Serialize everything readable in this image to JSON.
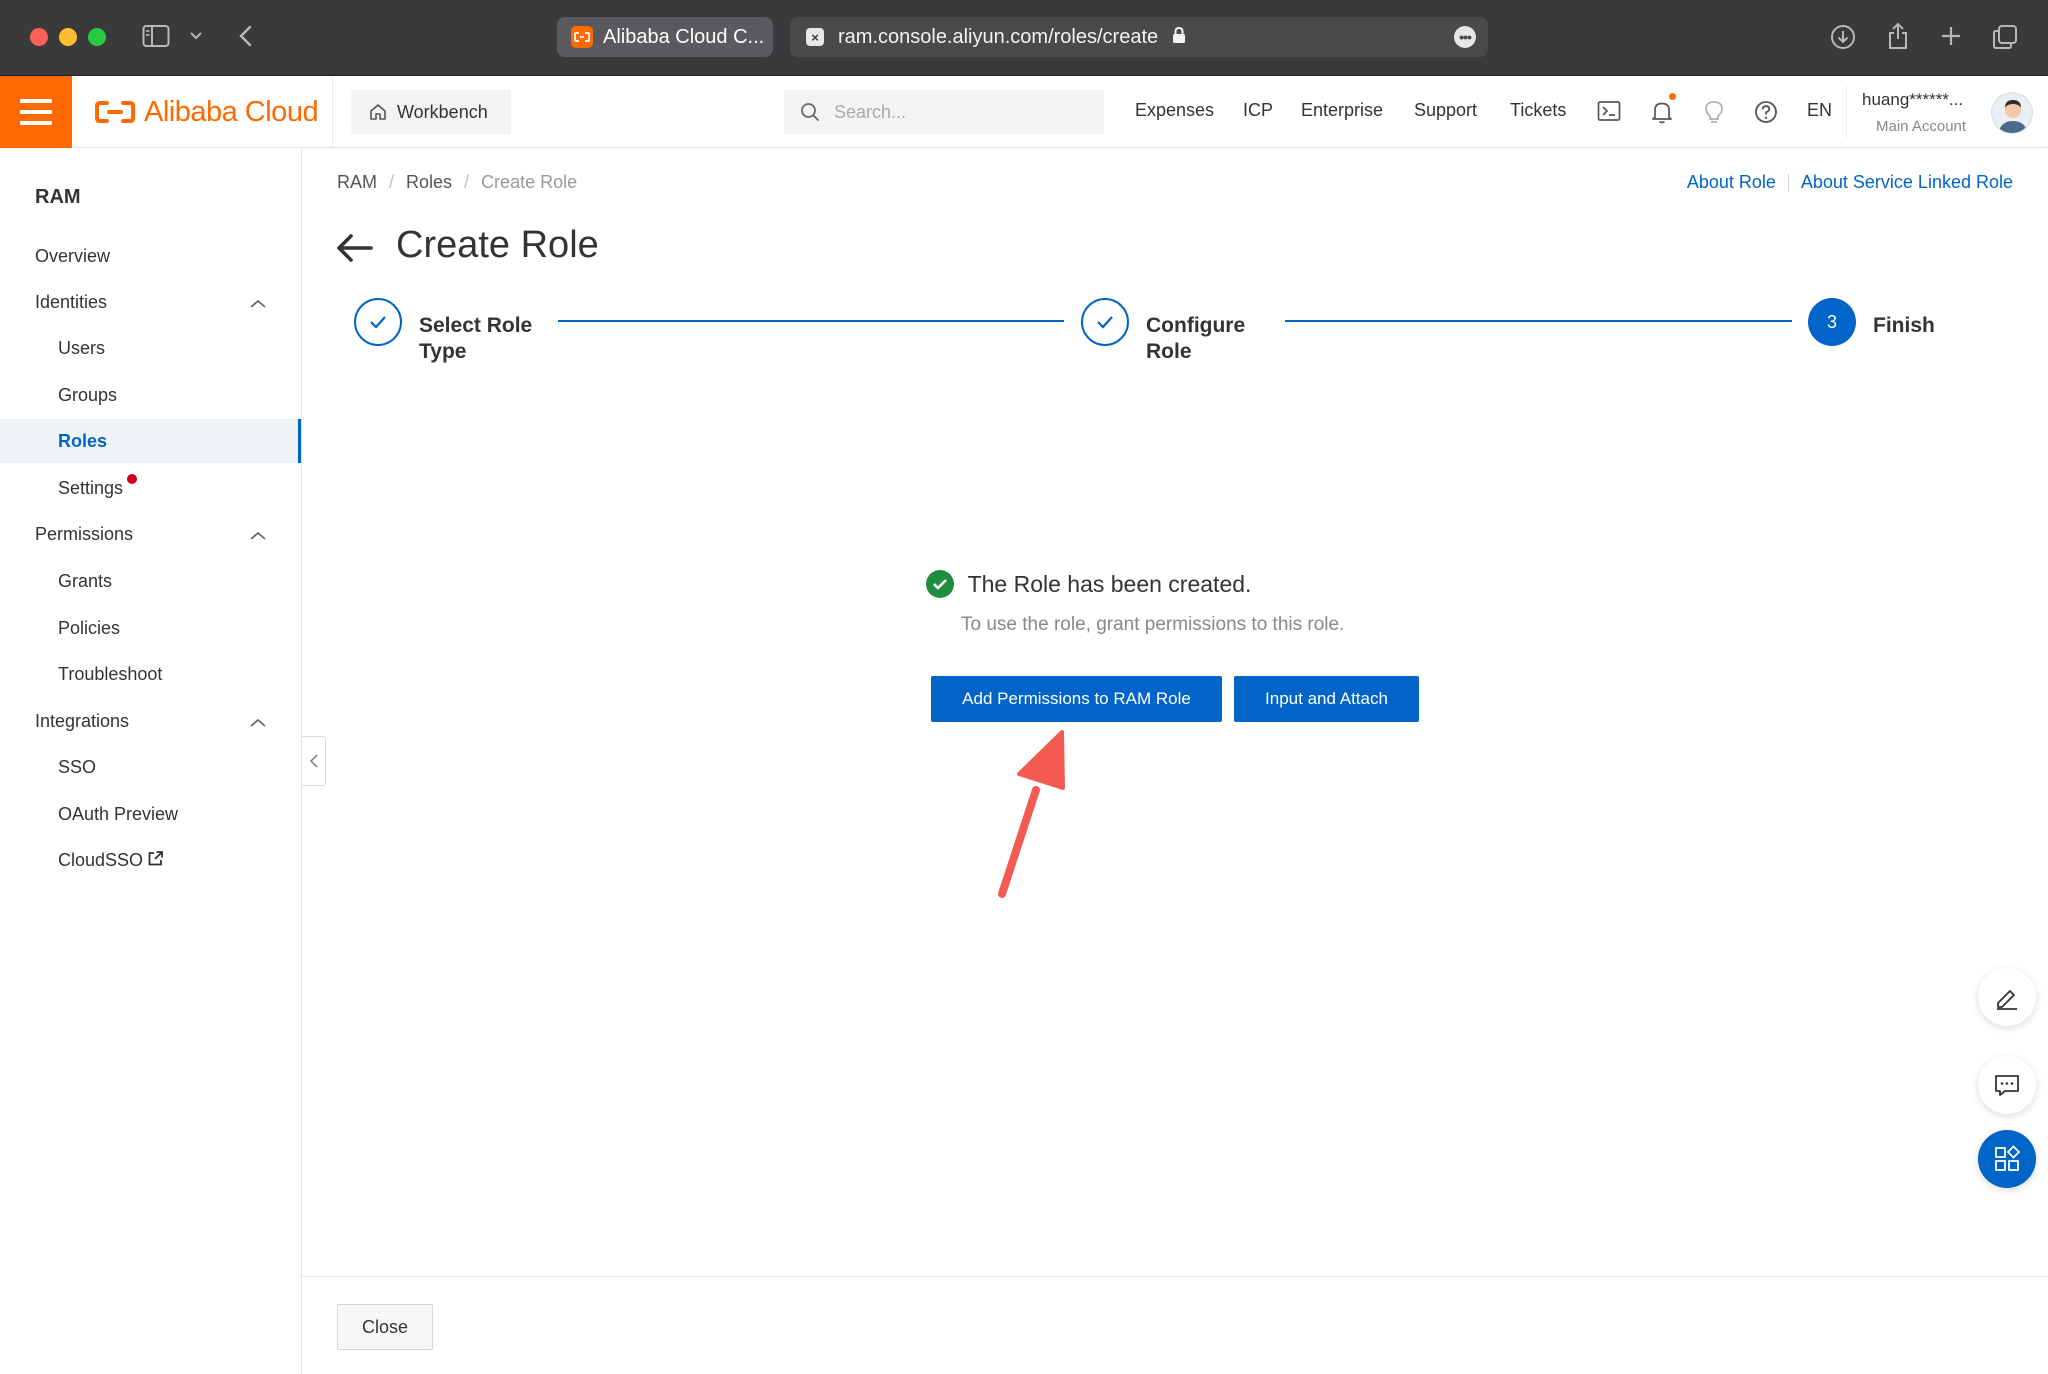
{
  "browser": {
    "tab_title": "Alibaba Cloud C...",
    "url": "ram.console.aliyun.com/roles/create",
    "url_favicon": "×"
  },
  "topbar": {
    "brand": "Alibaba Cloud",
    "workbench": "Workbench",
    "search_placeholder": "Search...",
    "nav": [
      "Expenses",
      "ICP",
      "Enterprise",
      "Support",
      "Tickets"
    ],
    "language": "EN",
    "account_name": "huang******...",
    "account_type": "Main Account",
    "brand_color": "#ff6a00"
  },
  "sidebar": {
    "title": "RAM",
    "items": [
      {
        "label": "Overview"
      },
      {
        "label": "Identities"
      },
      {
        "label": "Users"
      },
      {
        "label": "Groups"
      },
      {
        "label": "Roles"
      },
      {
        "label": "Settings"
      },
      {
        "label": "Permissions"
      },
      {
        "label": "Grants"
      },
      {
        "label": "Policies"
      },
      {
        "label": "Troubleshoot"
      },
      {
        "label": "Integrations"
      },
      {
        "label": "SSO"
      },
      {
        "label": "OAuth Preview"
      },
      {
        "label": "CloudSSO"
      }
    ]
  },
  "breadcrumb": [
    "RAM",
    "Roles",
    "Create Role"
  ],
  "help_links": [
    "About Role",
    "About Service Linked Role"
  ],
  "page_title": "Create Role",
  "steps": [
    {
      "label_line1": "Select Role",
      "label_line2": "Type",
      "status": "done"
    },
    {
      "label_line1": "Configure",
      "label_line2": "Role",
      "status": "done"
    },
    {
      "number": "3",
      "label_line1": "Finish",
      "status": "current"
    }
  ],
  "result": {
    "title": "The Role has been created.",
    "subtitle": "To use the role, grant permissions to this role.",
    "primary_button": "Add Permissions to RAM Role",
    "secondary_button": "Input and Attach"
  },
  "footer": {
    "close_button": "Close"
  },
  "colors": {
    "accent": "#0064c8",
    "success": "#1e8e3e",
    "annotation": "#f25a52"
  }
}
